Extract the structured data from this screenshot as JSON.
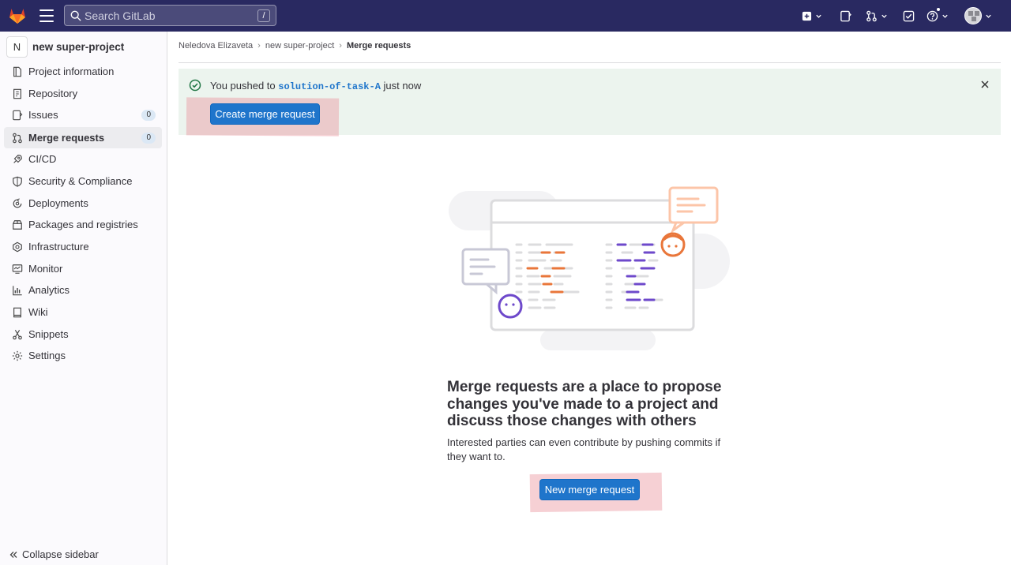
{
  "topbar": {
    "search_placeholder": "Search GitLab",
    "search_shortcut": "/",
    "icons": [
      "gitlab-logo",
      "hamburger-menu-icon",
      "search-icon",
      "plus-square-icon",
      "issues-icon",
      "merge-request-icon",
      "todo-icon",
      "help-icon",
      "avatar"
    ],
    "accent_color": "#292961"
  },
  "sidebar": {
    "project_initial": "N",
    "project_name": "new super-project",
    "items": [
      {
        "label": "Project information",
        "icon": "project-info-icon"
      },
      {
        "label": "Repository",
        "icon": "repository-icon"
      },
      {
        "label": "Issues",
        "icon": "issues-icon",
        "count": "0"
      },
      {
        "label": "Merge requests",
        "icon": "merge-request-icon",
        "count": "0",
        "active": true
      },
      {
        "label": "CI/CD",
        "icon": "rocket-icon"
      },
      {
        "label": "Security & Compliance",
        "icon": "shield-icon"
      },
      {
        "label": "Deployments",
        "icon": "deployments-icon"
      },
      {
        "label": "Packages and registries",
        "icon": "package-icon"
      },
      {
        "label": "Infrastructure",
        "icon": "cloud-gear-icon"
      },
      {
        "label": "Monitor",
        "icon": "monitor-icon"
      },
      {
        "label": "Analytics",
        "icon": "chart-icon"
      },
      {
        "label": "Wiki",
        "icon": "book-icon"
      },
      {
        "label": "Snippets",
        "icon": "snippet-icon"
      },
      {
        "label": "Settings",
        "icon": "gear-icon"
      }
    ],
    "collapse_label": "Collapse sidebar"
  },
  "breadcrumb": {
    "items": [
      "Neledova Elizaveta",
      "new super-project",
      "Merge requests"
    ]
  },
  "alert": {
    "prefix": "You pushed to",
    "branch": "solution-of-task-A",
    "suffix": "just now",
    "button_label": "Create merge request"
  },
  "empty_state": {
    "title": "Merge requests are a place to propose changes you've made to a project and discuss those changes with others",
    "description": "Interested parties can even contribute by pushing commits if they want to.",
    "button_label": "New merge request"
  }
}
